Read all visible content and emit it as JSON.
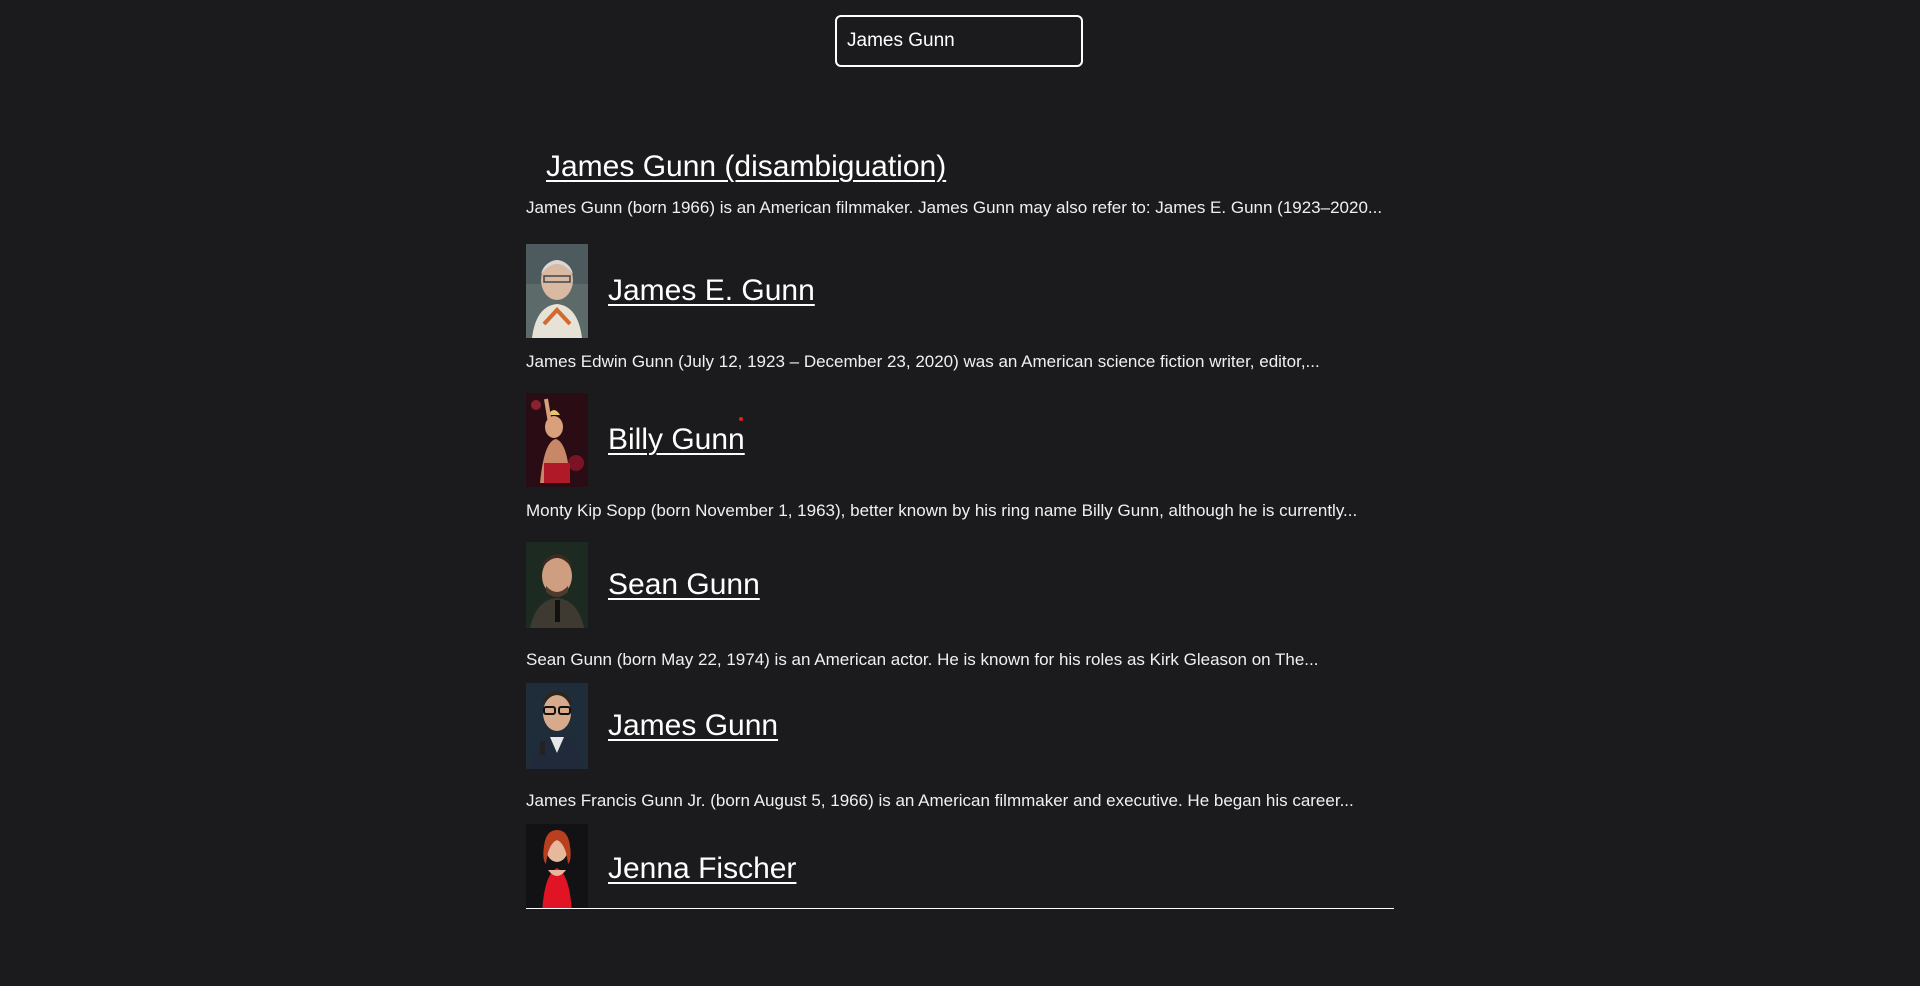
{
  "search": {
    "value": "James Gunn"
  },
  "results": [
    {
      "title": "James Gunn (disambiguation)",
      "snippet": "James Gunn (born 1966) is an American filmmaker. James Gunn may also refer to: James E. Gunn (1923–2020..."
    },
    {
      "title": "James E. Gunn",
      "snippet": "James Edwin Gunn (July 12, 1923 – December 23, 2020) was an American science fiction writer, editor,...",
      "thumb": "portrait-photo"
    },
    {
      "title": "Billy Gunn",
      "snippet": "Monty Kip Sopp (born November 1, 1963), better known by his ring name Billy Gunn, although he is currently...",
      "thumb": "portrait-photo"
    },
    {
      "title": "Sean Gunn",
      "snippet": "Sean Gunn (born May 22, 1974) is an American actor. He is known for his roles as Kirk Gleason on The...",
      "thumb": "portrait-photo"
    },
    {
      "title": "James Gunn",
      "snippet": "James Francis Gunn Jr. (born August 5, 1966) is an American filmmaker and executive. He began his career...",
      "thumb": "portrait-photo"
    },
    {
      "title": "Jenna Fischer",
      "snippet": "",
      "thumb": "portrait-photo"
    }
  ],
  "colors": {
    "background": "#1b1b1d",
    "text": "#ffffff"
  }
}
